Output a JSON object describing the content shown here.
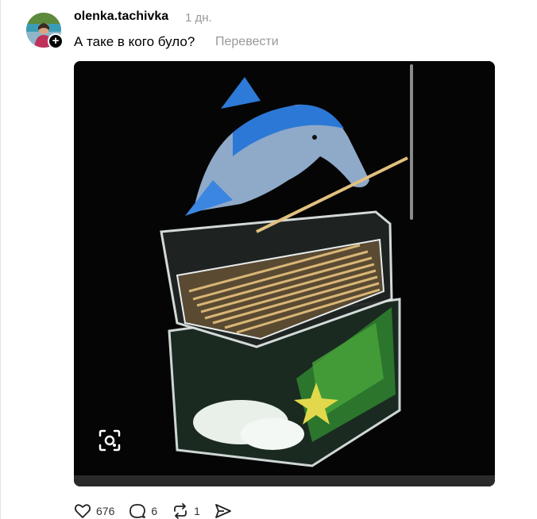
{
  "post": {
    "username": "olenka.tachivka",
    "time": "1 дн.",
    "caption": "А таке в кого було?",
    "translate_label": "Перевести"
  },
  "media": {
    "lens_icon": "visual-search-icon"
  },
  "actions": {
    "likes": "676",
    "comments": "6",
    "reposts": "1",
    "like_icon": "heart-icon",
    "comment_icon": "comment-icon",
    "repost_icon": "repost-icon",
    "share_icon": "send-icon"
  }
}
